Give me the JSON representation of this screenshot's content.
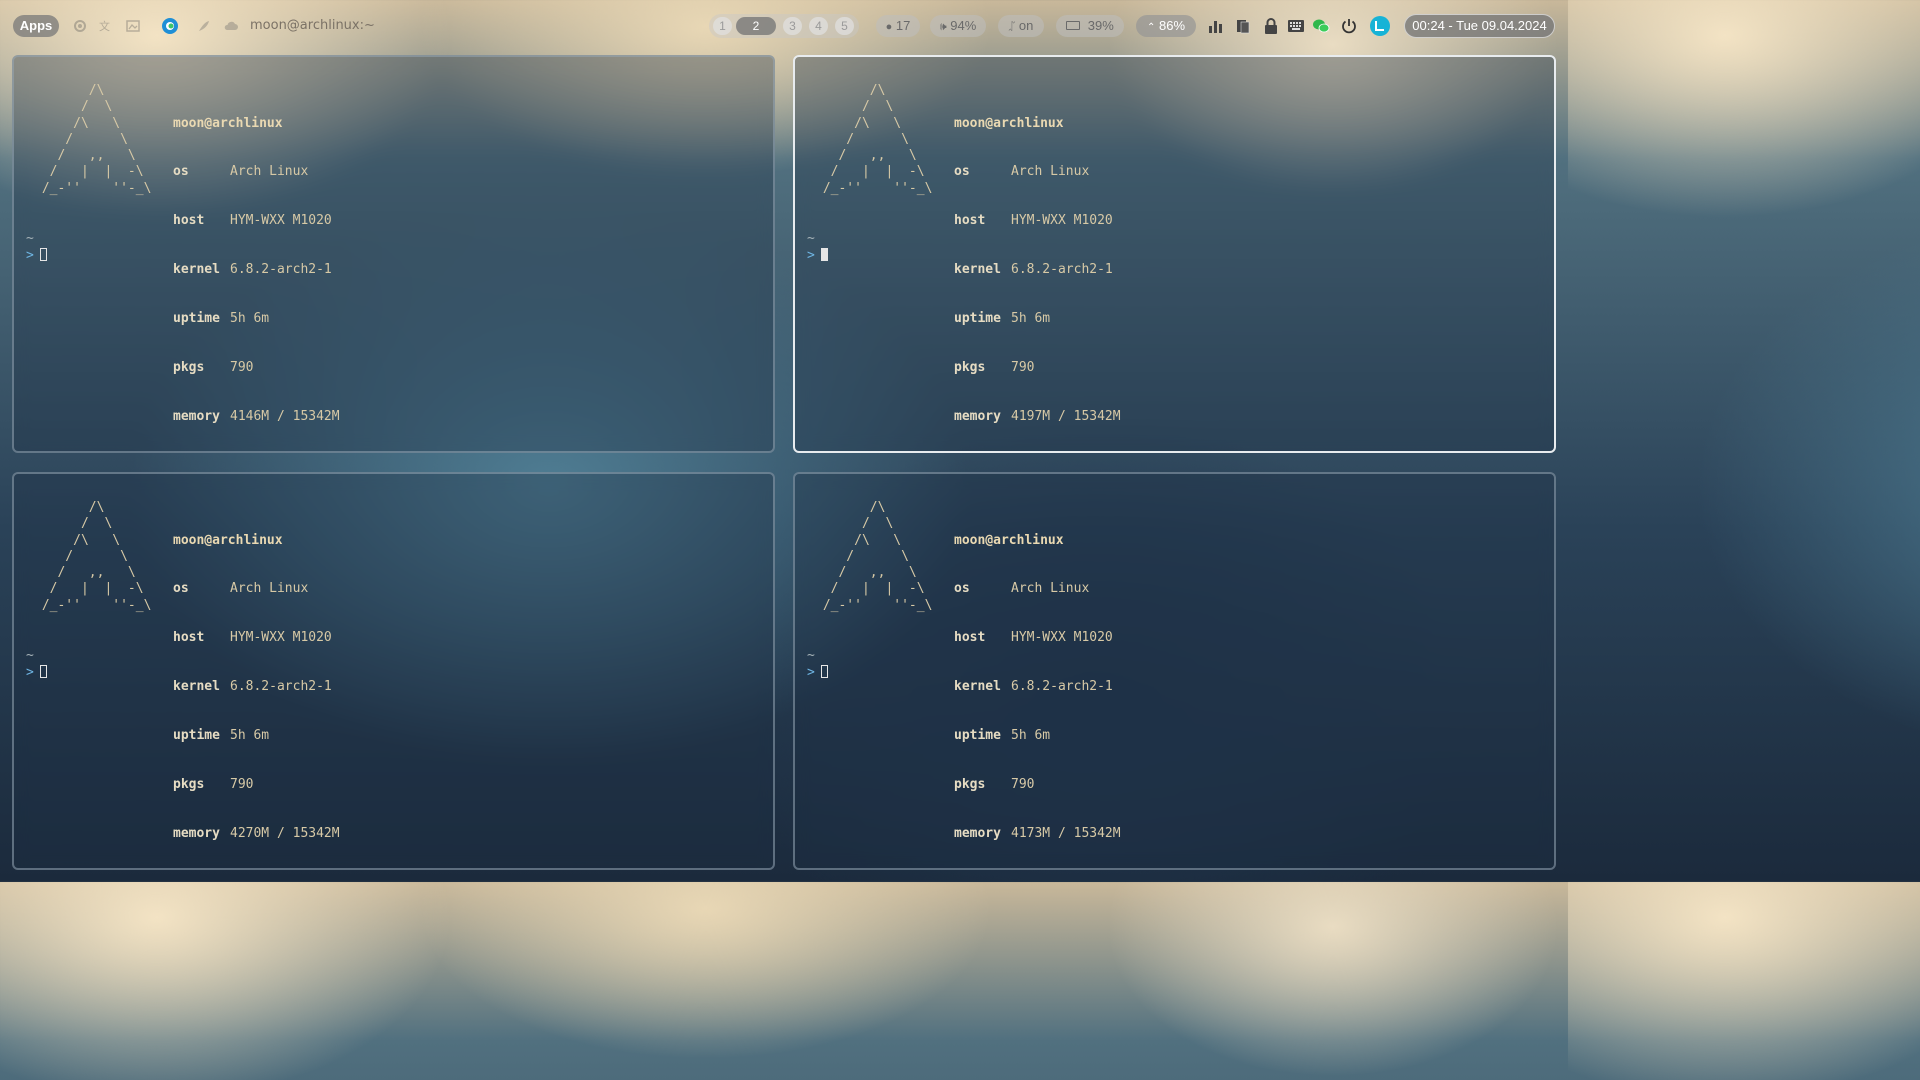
{
  "topbar": {
    "apps_label": "Apps",
    "window_title": "moon@archlinux:~",
    "tray_icons": [
      "settings-icon",
      "translate-icon",
      "screenshot-icon",
      "edge-browser-icon",
      "feather-icon",
      "cloud-icon"
    ],
    "workspaces": [
      "1",
      "2",
      "3",
      "4",
      "5"
    ],
    "active_workspace": "2",
    "updates": "17",
    "volume": "94%",
    "bluetooth": "on",
    "battery": "39%",
    "wifi": "86%",
    "status_icons": [
      "bar-chart-icon",
      "clipboard-icon",
      "lock-icon",
      "keyboard-icon",
      "wechat-icon",
      "power-icon",
      "app-logo-icon"
    ],
    "clock": "00:24 - Tue 09.04.2024"
  },
  "fetch_labels": {
    "os": "os",
    "host": "host",
    "kernel": "kernel",
    "uptime": "uptime",
    "pkgs": "pkgs",
    "memory": "memory"
  },
  "terminals": [
    {
      "userhost": "moon@archlinux",
      "os": "Arch Linux",
      "host": "HYM-WXX M1020",
      "kernel": "6.8.2-arch2-1",
      "uptime": "5h 6m",
      "pkgs": "790",
      "memory": "4146M / 15342M",
      "cwd": "~",
      "prompt": ">"
    },
    {
      "userhost": "moon@archlinux",
      "os": "Arch Linux",
      "host": "HYM-WXX M1020",
      "kernel": "6.8.2-arch2-1",
      "uptime": "5h 6m",
      "pkgs": "790",
      "memory": "4197M / 15342M",
      "cwd": "~",
      "prompt": ">"
    },
    {
      "userhost": "moon@archlinux",
      "os": "Arch Linux",
      "host": "HYM-WXX M1020",
      "kernel": "6.8.2-arch2-1",
      "uptime": "5h 6m",
      "pkgs": "790",
      "memory": "4270M / 15342M",
      "cwd": "~",
      "prompt": ">"
    },
    {
      "userhost": "moon@archlinux",
      "os": "Arch Linux",
      "host": "HYM-WXX M1020",
      "kernel": "6.8.2-arch2-1",
      "uptime": "5h 6m",
      "pkgs": "790",
      "memory": "4173M / 15342M",
      "cwd": "~",
      "prompt": ">"
    }
  ]
}
